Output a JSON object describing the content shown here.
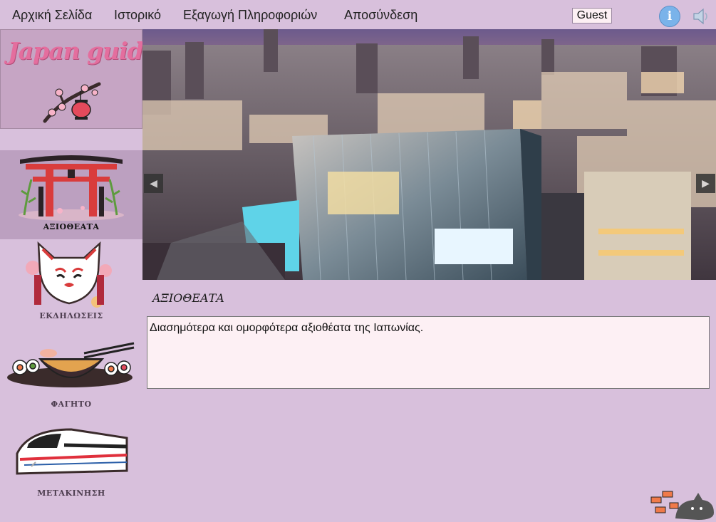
{
  "nav": {
    "home": "Αρχική Σελίδα",
    "history": "Ιστορικό",
    "export": "Εξαγωγή Πληροφοριών",
    "logout": "Αποσύνδεση",
    "user": "Guest",
    "info_icon": "info-icon",
    "sound_icon": "speaker-icon"
  },
  "logo": {
    "text": "Japan guide"
  },
  "sidebar": {
    "items": [
      {
        "label": "ΑΞΙΟΘΕΑΤΑ",
        "icon": "torii-gate-icon",
        "active": true
      },
      {
        "label": "ΕΚΔΗΛΩΣΕΙΣ",
        "icon": "kitsune-mask-icon",
        "active": false
      },
      {
        "label": "ΦΑΓΗΤΟ",
        "icon": "ramen-sushi-icon",
        "active": false
      },
      {
        "label": "ΜΕΤΑΚΙΝΗΣΗ",
        "icon": "bullet-train-icon",
        "active": false
      }
    ]
  },
  "hero": {
    "prev": "◀",
    "next": "▶"
  },
  "section": {
    "title": "ΑΞΙΟΘΕΑΤΑ",
    "description": "Διασημότερα και ομορφότερα αξιοθέατα της Ιαπωνίας."
  },
  "colors": {
    "background": "#d8c0dc",
    "accent": "#e46e9e",
    "active_item": "#bca0c0"
  }
}
